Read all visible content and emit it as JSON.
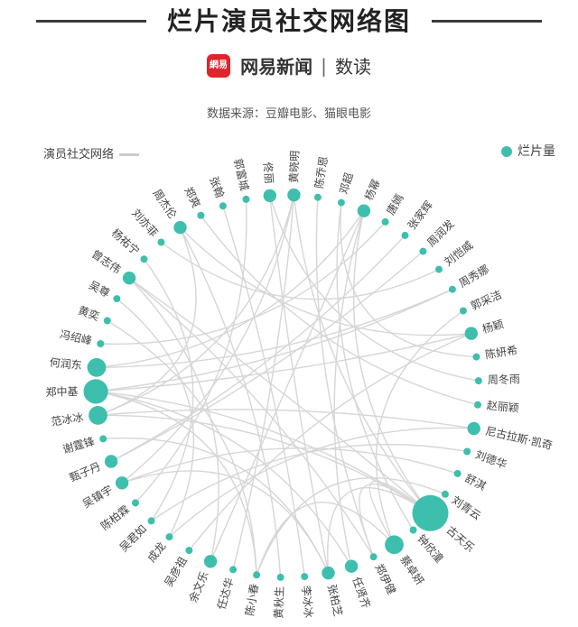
{
  "title": "烂片演员社交网络图",
  "brand": {
    "logo_text": "網易",
    "name": "网易新闻",
    "separator": "|",
    "sub": "数读"
  },
  "source": "数据来源：豆瓣电影、猫眼电影",
  "legend": {
    "network_label": "演员社交网络",
    "size_label": "烂片量"
  },
  "colors": {
    "node": "#3ebfad",
    "edge": "#d6d6d6",
    "text": "#444444"
  },
  "network": {
    "nodes": [
      {
        "name": "黄晓明",
        "size": 2
      },
      {
        "name": "陈乔恩",
        "size": 1
      },
      {
        "name": "邓超",
        "size": 1
      },
      {
        "name": "杨幂",
        "size": 2
      },
      {
        "name": "唐嫣",
        "size": 1
      },
      {
        "name": "张家辉",
        "size": 1
      },
      {
        "name": "周润发",
        "size": 1
      },
      {
        "name": "刘恺威",
        "size": 1
      },
      {
        "name": "周秀娜",
        "size": 1
      },
      {
        "name": "郭采洁",
        "size": 1
      },
      {
        "name": "杨颖",
        "size": 2
      },
      {
        "name": "陈妍希",
        "size": 1
      },
      {
        "name": "周冬雨",
        "size": 1
      },
      {
        "name": "赵丽颖",
        "size": 1
      },
      {
        "name": "尼古拉斯·凯奇",
        "size": 2
      },
      {
        "name": "刘德华",
        "size": 1
      },
      {
        "name": "舒淇",
        "size": 1
      },
      {
        "name": "刘青云",
        "size": 1
      },
      {
        "name": "古天乐",
        "size": 6
      },
      {
        "name": "钟欣潼",
        "size": 1
      },
      {
        "name": "蔡卓妍",
        "size": 3
      },
      {
        "name": "郑伊健",
        "size": 1
      },
      {
        "name": "任贤齐",
        "size": 2
      },
      {
        "name": "张柏芝",
        "size": 2
      },
      {
        "name": "李冰冰",
        "size": 1
      },
      {
        "name": "黄秋生",
        "size": 1
      },
      {
        "name": "陈小春",
        "size": 1
      },
      {
        "name": "任达华",
        "size": 1
      },
      {
        "name": "余文乐",
        "size": 2
      },
      {
        "name": "吴彦祖",
        "size": 1
      },
      {
        "name": "成龙",
        "size": 1
      },
      {
        "name": "吴君如",
        "size": 1
      },
      {
        "name": "陈柏霖",
        "size": 1
      },
      {
        "name": "吴镇宇",
        "size": 2
      },
      {
        "name": "甄子丹",
        "size": 2
      },
      {
        "name": "谢霆锋",
        "size": 1
      },
      {
        "name": "范冰冰",
        "size": 3
      },
      {
        "name": "郑中基",
        "size": 4
      },
      {
        "name": "何润东",
        "size": 3
      },
      {
        "name": "冯绍峰",
        "size": 1
      },
      {
        "name": "黄奕",
        "size": 1
      },
      {
        "name": "吴尊",
        "size": 1
      },
      {
        "name": "曾志伟",
        "size": 2
      },
      {
        "name": "杨祐宁",
        "size": 1
      },
      {
        "name": "刘亦菲",
        "size": 1
      },
      {
        "name": "周杰伦",
        "size": 2
      },
      {
        "name": "郑爽",
        "size": 1
      },
      {
        "name": "张翰",
        "size": 1
      },
      {
        "name": "郭富城",
        "size": 1
      },
      {
        "name": "佟丽",
        "size": 2
      }
    ],
    "edges": [
      [
        18,
        37
      ],
      [
        18,
        36
      ],
      [
        18,
        0
      ],
      [
        18,
        3
      ],
      [
        18,
        23
      ],
      [
        18,
        20
      ],
      [
        18,
        42
      ],
      [
        0,
        36
      ],
      [
        0,
        27
      ],
      [
        0,
        33
      ],
      [
        3,
        28
      ],
      [
        3,
        22
      ],
      [
        3,
        38
      ],
      [
        37,
        22
      ],
      [
        37,
        26
      ],
      [
        37,
        10
      ],
      [
        36,
        14
      ],
      [
        36,
        45
      ],
      [
        14,
        30
      ],
      [
        45,
        25
      ],
      [
        45,
        10
      ],
      [
        49,
        23
      ],
      [
        49,
        12
      ],
      [
        42,
        28
      ],
      [
        42,
        21
      ],
      [
        33,
        23
      ],
      [
        33,
        16
      ],
      [
        24,
        47
      ],
      [
        34,
        5
      ],
      [
        38,
        8
      ],
      [
        40,
        26
      ],
      [
        10,
        29
      ],
      [
        9,
        20
      ],
      [
        35,
        23
      ],
      [
        31,
        15
      ],
      [
        1,
        21
      ],
      [
        2,
        11
      ],
      [
        4,
        39
      ],
      [
        6,
        34
      ],
      [
        7,
        44
      ],
      [
        13,
        46
      ],
      [
        17,
        26
      ],
      [
        19,
        2
      ],
      [
        43,
        31
      ],
      [
        48,
        32
      ],
      [
        41,
        30
      ],
      [
        20,
        26
      ],
      [
        21,
        18
      ],
      [
        37,
        8
      ]
    ]
  }
}
